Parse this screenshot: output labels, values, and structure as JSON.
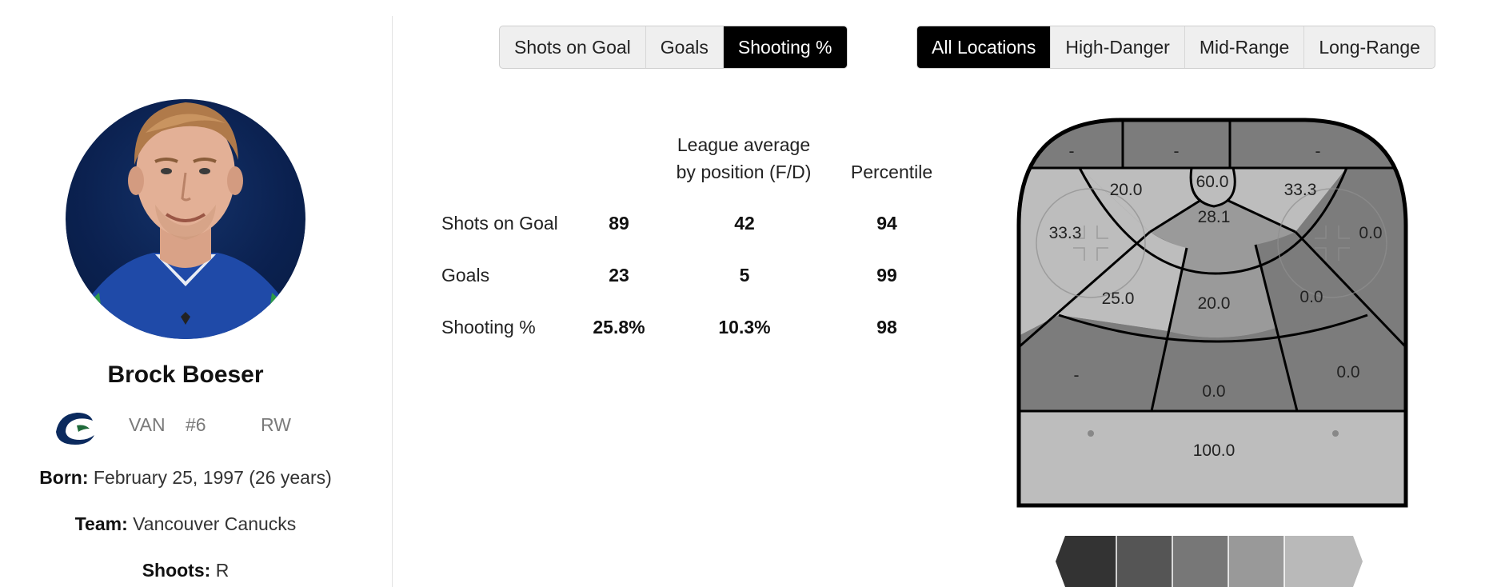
{
  "player": {
    "name": "Brock Boeser",
    "team_abbr": "VAN",
    "jersey": "#6",
    "position": "RW",
    "born_label": "Born:",
    "born_value": "February 25, 1997 (26 years)",
    "team_label": "Team:",
    "team_value": "Vancouver Canucks",
    "shoots_label": "Shoots:",
    "shoots_value": "R",
    "avatar_icon": "player-headshot",
    "team_logo_icon": "canucks-orca-logo"
  },
  "metric_toggle": {
    "options": [
      "Shots on Goal",
      "Goals",
      "Shooting %"
    ],
    "selected": "Shooting %"
  },
  "location_toggle": {
    "options": [
      "All Locations",
      "High-Danger",
      "Mid-Range",
      "Long-Range"
    ],
    "selected": "All Locations"
  },
  "stats": {
    "header_league": "League average by position (F/D)",
    "header_league_line1": "League average",
    "header_league_line2": "by position (F/D)",
    "header_percentile": "Percentile",
    "rows": [
      {
        "label": "Shots on Goal",
        "player": "89",
        "league": "42",
        "percentile": "94"
      },
      {
        "label": "Goals",
        "player": "23",
        "league": "5",
        "percentile": "99"
      },
      {
        "label": "Shooting %",
        "player": "25.8%",
        "league": "10.3%",
        "percentile": "98"
      }
    ]
  },
  "rink_zones": {
    "top_left": "-",
    "top_mid": "-",
    "top_right": "-",
    "arc_left": "20.0",
    "slot_top": "60.0",
    "arc_right": "33.3",
    "slot": "28.1",
    "left_wide": "33.3",
    "right_wide": "0.0",
    "left_circle": "25.0",
    "mid_slot": "20.0",
    "right_circle": "0.0",
    "left_point": "-",
    "center_point": "0.0",
    "right_point": "0.0",
    "blue_line": "100.0"
  },
  "colors": {
    "active_toggle": "#000000",
    "toggle_bg": "#efefef",
    "zone_light": "#bdbdbd",
    "zone_mid": "#9a9a9a",
    "zone_dark": "#7c7c7c",
    "legend": [
      "#333333",
      "#555555",
      "#777777",
      "#999999",
      "#b9b9b9"
    ]
  }
}
